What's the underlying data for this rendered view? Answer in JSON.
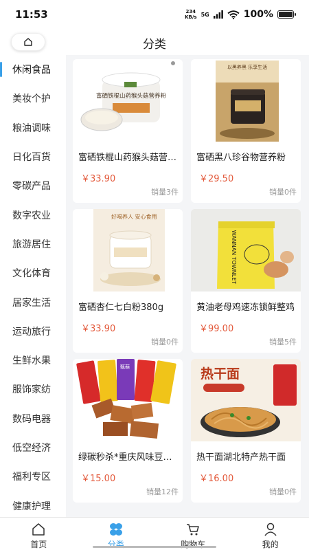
{
  "status_bar": {
    "time": "11:53",
    "net_speed_value": "234",
    "net_speed_unit": "KB/s",
    "network": "5G",
    "battery": "100%"
  },
  "header": {
    "title": "分类"
  },
  "sidebar": {
    "items": [
      {
        "label": "休闲食品",
        "active": true
      },
      {
        "label": "美妆个护"
      },
      {
        "label": "粮油调味"
      },
      {
        "label": "日化百货"
      },
      {
        "label": "零碳产品"
      },
      {
        "label": "数字农业"
      },
      {
        "label": "旅游居住"
      },
      {
        "label": "文化体育"
      },
      {
        "label": "居家生活"
      },
      {
        "label": "运动旅行"
      },
      {
        "label": "生鲜水果"
      },
      {
        "label": "服饰家纺"
      },
      {
        "label": "数码电器"
      },
      {
        "label": "低空经济"
      },
      {
        "label": "福利专区"
      },
      {
        "label": "健康护理"
      }
    ]
  },
  "products": [
    {
      "name": "富硒铁棍山药猴头菇营养粉",
      "price": "￥33.90",
      "sales": "销量3件",
      "img_text": "富硒铁棍山药猴头菇营养粉"
    },
    {
      "name": "富硒黑八珍谷物营养粉",
      "price": "￥29.50",
      "sales": "销量0件",
      "img_text": "以黑养黑 乐享生活"
    },
    {
      "name": "富硒杏仁七白粉380g",
      "price": "￥33.90",
      "sales": "销量0件",
      "img_text": "好喝养人 安心食用"
    },
    {
      "name": "黄油老母鸡速冻锁鲜整鸡",
      "price": "￥99.00",
      "sales": "销量5件",
      "img_text": "WANNAN TOWNLET"
    },
    {
      "name": "绿碳秒杀*重庆风味豆干零食",
      "price": "￥15.00",
      "sales": "销量12件",
      "img_text": "甄萌"
    },
    {
      "name": "热干面湖北特产热干面",
      "price": "￥16.00",
      "sales": "销量0件",
      "img_text": "热干面"
    }
  ],
  "bottom_nav": {
    "items": [
      {
        "label": "首页",
        "icon": "home-icon"
      },
      {
        "label": "分类",
        "icon": "category-icon",
        "active": true
      },
      {
        "label": "购物车",
        "icon": "cart-icon"
      },
      {
        "label": "我的",
        "icon": "profile-icon"
      }
    ]
  },
  "colors": {
    "accent": "#3aa0e8",
    "price": "#e35a3c"
  }
}
